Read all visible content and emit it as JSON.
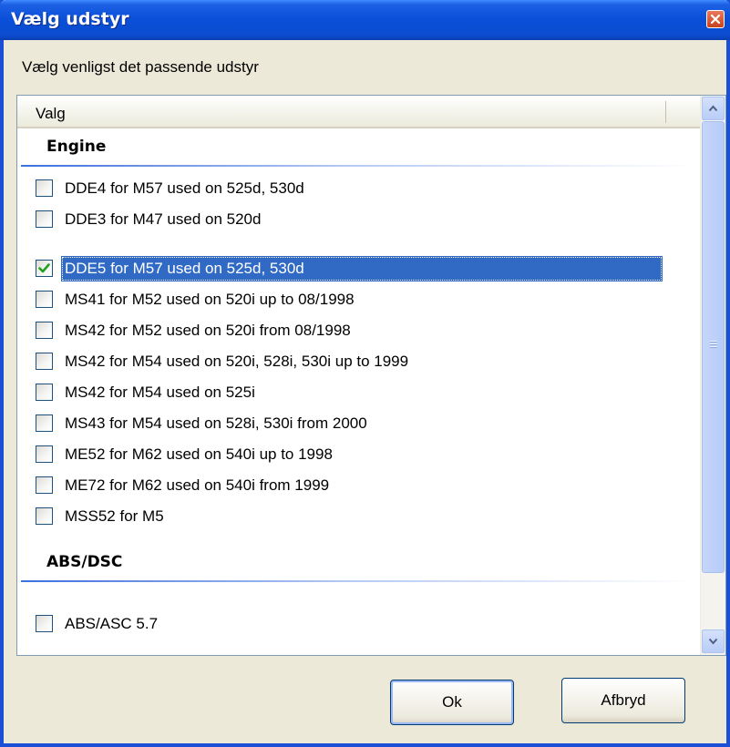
{
  "window": {
    "title": "Vælg udstyr",
    "close_icon": "close-icon",
    "prompt": "Vælg venligst det passende udstyr"
  },
  "list": {
    "column_header": "Valg",
    "groups": [
      {
        "label": "Engine",
        "items": [
          {
            "label": "DDE4 for M57 used on 525d, 530d",
            "checked": false
          },
          {
            "label": "DDE3 for M47 used on 520d",
            "checked": false
          },
          {
            "label": "DDE5 for M57 used on 525d, 530d",
            "checked": true,
            "selected": true
          },
          {
            "label": "MS41 for M52 used on 520i up to 08/1998",
            "checked": false
          },
          {
            "label": "MS42 for M52 used on 520i from 08/1998",
            "checked": false
          },
          {
            "label": "MS42 for M54 used on 520i, 528i, 530i up to 1999",
            "checked": false
          },
          {
            "label": "MS42 for M54 used on 525i",
            "checked": false
          },
          {
            "label": "MS43 for M54 used on 528i, 530i from 2000",
            "checked": false
          },
          {
            "label": "ME52 for M62 used on 540i up to 1998",
            "checked": false
          },
          {
            "label": "ME72 for M62 used on 540i from 1999",
            "checked": false
          },
          {
            "label": "MSS52 for M5",
            "checked": false
          }
        ]
      },
      {
        "label": "ABS/DSC",
        "items": [
          {
            "label": "ABS/ASC  5.7",
            "checked": false
          }
        ]
      }
    ]
  },
  "buttons": {
    "ok": "Ok",
    "cancel": "Afbryd"
  },
  "colors": {
    "title_bar": "#0a4fd8",
    "selection": "#316ac5",
    "dialog_bg": "#ece9d8"
  }
}
